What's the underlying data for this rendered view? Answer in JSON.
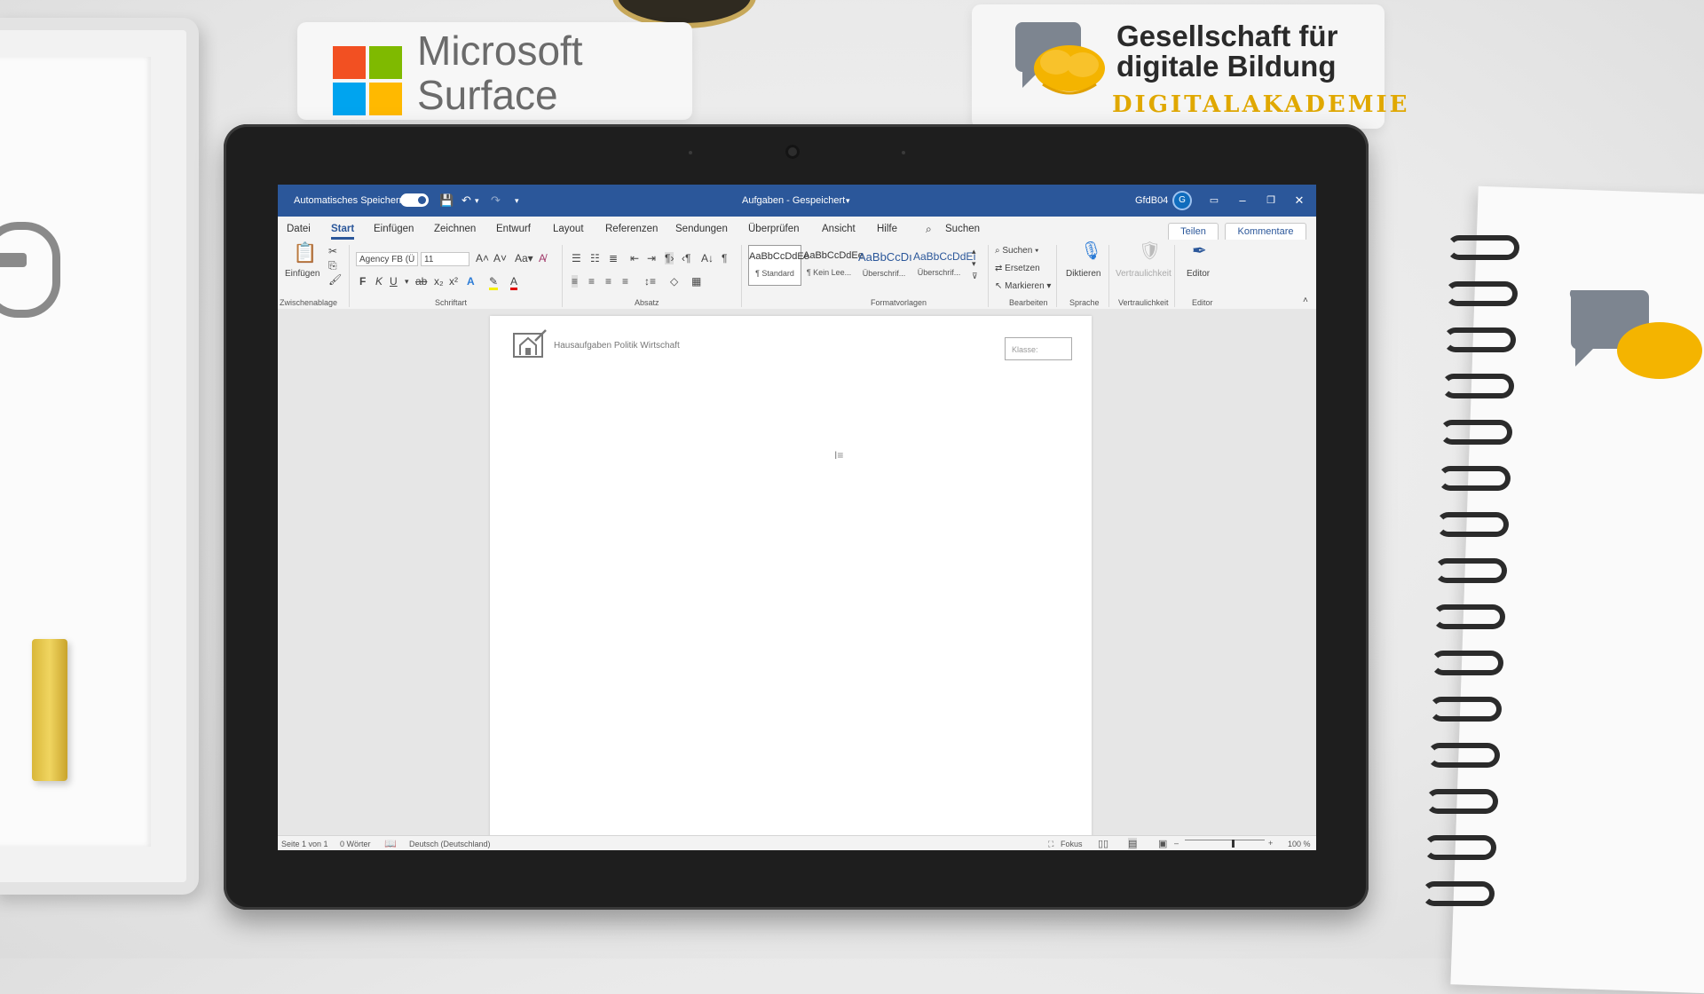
{
  "brand": {
    "ms_line1": "Microsoft",
    "ms_line2": "Surface",
    "gdb_line1": "Gesellschaft für",
    "gdb_line2": "digitale Bildung",
    "gdb_sub": "DIGITALAKADEMIE",
    "ms_colors": [
      "#f25022",
      "#7fba00",
      "#00a4ef",
      "#ffb900"
    ]
  },
  "titlebar": {
    "autosave_label": "Automatisches Speichern",
    "doc_title": "Aufgaben - Gespeichert",
    "user_name": "GfdB04",
    "avatar_initial": "G",
    "accent": "#2b579a"
  },
  "menu": {
    "tabs": [
      "Datei",
      "Start",
      "Einfügen",
      "Zeichnen",
      "Entwurf",
      "Layout",
      "Referenzen",
      "Sendungen",
      "Überprüfen",
      "Ansicht",
      "Hilfe"
    ],
    "active_tab": "Start",
    "search_label": "Suchen",
    "share_label": "Teilen",
    "comments_label": "Kommentare"
  },
  "ribbon": {
    "paste_label": "Einfügen",
    "clipboard_group": "Zwischenablage",
    "font_name": "Agency FB (Ü",
    "font_size": "11",
    "font_group": "Schriftart",
    "paragraph_group": "Absatz",
    "styles_group": "Formatvorlagen",
    "styles": [
      {
        "sample": "AaBbCcDdEe",
        "name": "¶ Standard"
      },
      {
        "sample": "AaBbCcDdEe",
        "name": "¶ Kein Lee..."
      },
      {
        "sample": "AaBbCcDı",
        "name": "Überschrif..."
      },
      {
        "sample": "AaBbCcDdEı",
        "name": "Überschrif..."
      }
    ],
    "edit_find": "Suchen",
    "edit_replace": "Ersetzen",
    "edit_select": "Markieren",
    "edit_group": "Bearbeiten",
    "dictate_label": "Diktieren",
    "speech_group": "Sprache",
    "sensitivity_label": "Vertraulichkeit",
    "sensitivity_group": "Vertraulichkeit",
    "editor_label": "Editor",
    "editor_group": "Editor"
  },
  "document": {
    "header_text": "Hausaufgaben Politik Wirtschaft",
    "class_field": "Klasse:"
  },
  "status": {
    "page": "Seite 1 von 1",
    "words": "0 Wörter",
    "language": "Deutsch (Deutschland)",
    "focus": "Fokus",
    "zoom": "100 %"
  }
}
